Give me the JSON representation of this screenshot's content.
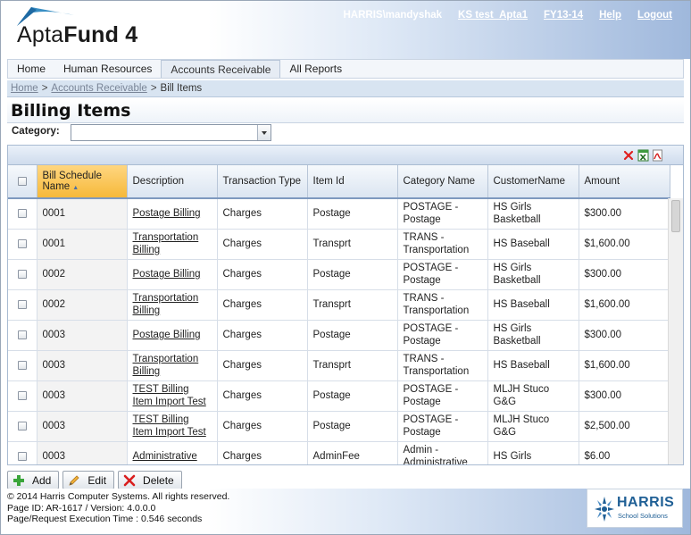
{
  "app": {
    "logo_text_light": "Apta",
    "logo_text_bold": "Fund 4"
  },
  "top_links": {
    "user": "HARRIS\\mandyshak",
    "org": "KS test_Apta1",
    "fiscal_year": "FY13-14",
    "help": "Help",
    "logout": "Logout"
  },
  "nav": {
    "tabs": [
      {
        "label": "Home"
      },
      {
        "label": "Human Resources"
      },
      {
        "label": "Accounts Receivable"
      },
      {
        "label": "All Reports"
      }
    ],
    "active": "Accounts Receivable"
  },
  "breadcrumb": {
    "home": "Home",
    "section": "Accounts Receivable",
    "current": "Bill Items"
  },
  "page": {
    "title": "Billing Items",
    "category_label": "Category:",
    "category_value": ""
  },
  "toolbar_icons": [
    "clear-filter-icon",
    "export-excel-icon",
    "export-pdf-icon"
  ],
  "grid": {
    "columns": [
      {
        "label": "Bill Schedule Name",
        "sorted": "ascending"
      },
      {
        "label": "Description"
      },
      {
        "label": "Transaction Type"
      },
      {
        "label": "Item Id"
      },
      {
        "label": "Category Name"
      },
      {
        "label": "CustomerName"
      },
      {
        "label": "Amount"
      }
    ],
    "rows": [
      {
        "schedule": "0001",
        "description": "Postage Billing",
        "type": "Charges",
        "item_id": "Postage",
        "category": "POSTAGE - Postage",
        "customer": "HS Girls Basketball",
        "amount": "$300.00"
      },
      {
        "schedule": "0001",
        "description": "Transportation Billing",
        "type": "Charges",
        "item_id": "Transprt",
        "category": "TRANS - Transportation",
        "customer": "HS Baseball",
        "amount": "$1,600.00"
      },
      {
        "schedule": "0002",
        "description": "Postage Billing",
        "type": "Charges",
        "item_id": "Postage",
        "category": "POSTAGE - Postage",
        "customer": "HS Girls Basketball",
        "amount": "$300.00"
      },
      {
        "schedule": "0002",
        "description": "Transportation Billing",
        "type": "Charges",
        "item_id": "Transprt",
        "category": "TRANS - Transportation",
        "customer": "HS Baseball",
        "amount": "$1,600.00"
      },
      {
        "schedule": "0003",
        "description": "Postage Billing",
        "type": "Charges",
        "item_id": "Postage",
        "category": "POSTAGE - Postage",
        "customer": "HS Girls Basketball",
        "amount": "$300.00"
      },
      {
        "schedule": "0003",
        "description": "Transportation Billing",
        "type": "Charges",
        "item_id": "Transprt",
        "category": "TRANS - Transportation",
        "customer": "HS Baseball",
        "amount": "$1,600.00"
      },
      {
        "schedule": "0003",
        "description": "TEST Billing Item Import Test",
        "type": "Charges",
        "item_id": "Postage",
        "category": "POSTAGE - Postage",
        "customer": "MLJH Stuco G&G",
        "amount": "$300.00"
      },
      {
        "schedule": "0003",
        "description": "TEST Billing Item Import Test",
        "type": "Charges",
        "item_id": "Postage",
        "category": "POSTAGE - Postage",
        "customer": "MLJH Stuco G&G",
        "amount": "$2,500.00"
      },
      {
        "schedule": "0003",
        "description": "Administrative",
        "type": "Charges",
        "item_id": "AdminFee",
        "category": "Admin - Administrative",
        "customer": "HS Girls",
        "amount": "$6.00"
      }
    ]
  },
  "buttons": {
    "add": "Add",
    "edit": "Edit",
    "delete": "Delete"
  },
  "footer": {
    "copyright": "© 2014 Harris Computer Systems. All rights reserved.",
    "page_id": "Page ID: AR-1617 / Version: 4.0.0.0",
    "exec_time": "Page/Request Execution Time : 0.546 seconds",
    "brand": "HARRIS",
    "brand_sub": "School Solutions"
  },
  "colors": {
    "header_gradient_end": "#9fb8dc",
    "sorted_header": "#f6b93a",
    "accent_blue": "#2a5f9e"
  }
}
